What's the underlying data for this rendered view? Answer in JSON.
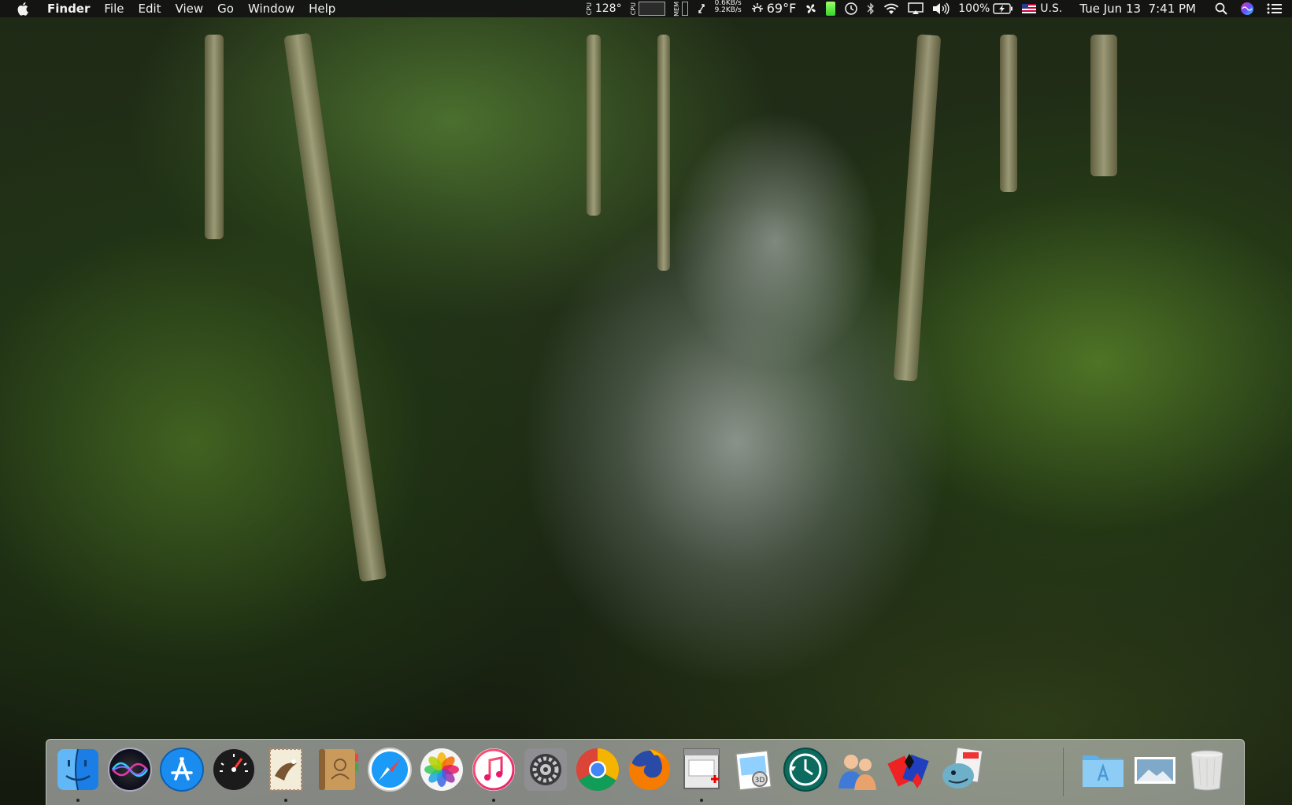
{
  "menubar": {
    "app_name": "Finder",
    "menus": [
      "File",
      "Edit",
      "View",
      "Go",
      "Window",
      "Help"
    ],
    "status": {
      "cpu_temp": "128°",
      "net_up": "0.6KB/s",
      "net_down": "9.2KB/s",
      "weather_temp": "69°F",
      "battery_percent": "100%",
      "input_source": "U.S.",
      "clock": "Tue Jun 13  7:41 PM"
    }
  },
  "icons": {
    "apple": "apple-logo-icon",
    "search": "spotlight-search-icon",
    "siri": "siri-icon",
    "notifications": "notification-center-icon"
  },
  "dock": {
    "apps": [
      {
        "name": "Finder",
        "icon": "finder-icon",
        "running": true
      },
      {
        "name": "Siri",
        "icon": "siri-icon",
        "running": false
      },
      {
        "name": "App Store",
        "icon": "app-store-icon",
        "running": false
      },
      {
        "name": "Dashboard",
        "icon": "dashboard-icon",
        "running": false
      },
      {
        "name": "Mail",
        "icon": "mail-icon",
        "running": true
      },
      {
        "name": "Contacts",
        "icon": "contacts-icon",
        "running": false
      },
      {
        "name": "Safari",
        "icon": "safari-icon",
        "running": false
      },
      {
        "name": "Photos",
        "icon": "photos-icon",
        "running": false
      },
      {
        "name": "iTunes",
        "icon": "itunes-icon",
        "running": true
      },
      {
        "name": "System Preferences",
        "icon": "system-preferences-icon",
        "running": false
      },
      {
        "name": "Google Chrome",
        "icon": "chrome-icon",
        "running": false
      },
      {
        "name": "Firefox",
        "icon": "firefox-icon",
        "running": false
      },
      {
        "name": "Activity Utility",
        "icon": "utility-app-icon",
        "running": true
      },
      {
        "name": "Preview",
        "icon": "preview-icon",
        "running": false
      },
      {
        "name": "Time Machine",
        "icon": "time-machine-icon",
        "running": false
      },
      {
        "name": "Users",
        "icon": "users-icon",
        "running": false
      },
      {
        "name": "Solitaire",
        "icon": "cards-game-icon",
        "running": false
      },
      {
        "name": "Sequel",
        "icon": "sequel-app-icon",
        "running": false
      }
    ],
    "stacks": [
      {
        "name": "Applications",
        "icon": "applications-folder-icon"
      },
      {
        "name": "Downloads",
        "icon": "image-stack-icon"
      },
      {
        "name": "Trash",
        "icon": "trash-icon"
      }
    ]
  },
  "colors": {
    "menubar_bg": "#141414",
    "menubar_text": "#f2f2f2",
    "battery_green": "#36d42a"
  }
}
